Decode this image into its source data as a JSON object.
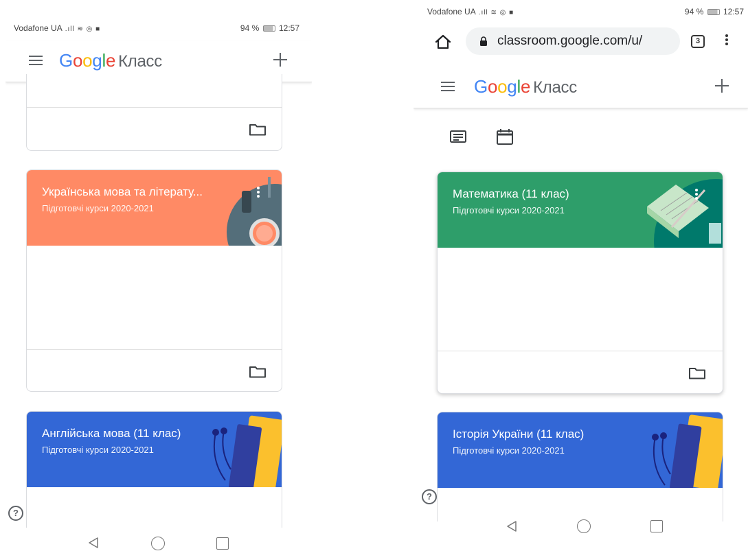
{
  "left": {
    "status": {
      "carrier": "Vodafone UA",
      "battery": "94 %",
      "time": "12:57"
    },
    "appbar": {
      "logo": "Google",
      "product": "Класс"
    },
    "courses": [
      {
        "title": "",
        "subtitle": "",
        "color": "#ffffff"
      },
      {
        "title": "Українська мова та літерату...",
        "subtitle": "Підготовчі курси 2020-2021",
        "color": "#ff8a65"
      },
      {
        "title": "Англійська мова (11 клас)",
        "subtitle": "Підготовчі курси 2020-2021",
        "color": "#3367d6"
      }
    ],
    "help": "?"
  },
  "right": {
    "status": {
      "carrier": "Vodafone UA",
      "battery": "94 %",
      "time": "12:57"
    },
    "browser": {
      "url": "classroom.google.com/u/",
      "tabs": "3"
    },
    "appbar": {
      "logo": "Google",
      "product": "Класс"
    },
    "courses": [
      {
        "title": "Математика (11 клас)",
        "subtitle": "Підготовчі курси 2020-2021",
        "color": "#2e9e6a"
      },
      {
        "title": "Історія України (11 клас)",
        "subtitle": "Підготовчі курси 2020-2021",
        "color": "#3367d6"
      }
    ],
    "help": "?"
  },
  "colors": {
    "accent_blue": "#4285f4",
    "accent_red": "#ea4335",
    "accent_yellow": "#fbbc05",
    "accent_green": "#34a853"
  },
  "icons": [
    "menu-icon",
    "plus-icon",
    "folder-icon",
    "stream-icon",
    "calendar-icon",
    "help-icon",
    "home-icon",
    "lock-icon",
    "tabs-icon",
    "more-vert-icon",
    "nav-back-icon",
    "nav-home-icon",
    "nav-recent-icon"
  ]
}
